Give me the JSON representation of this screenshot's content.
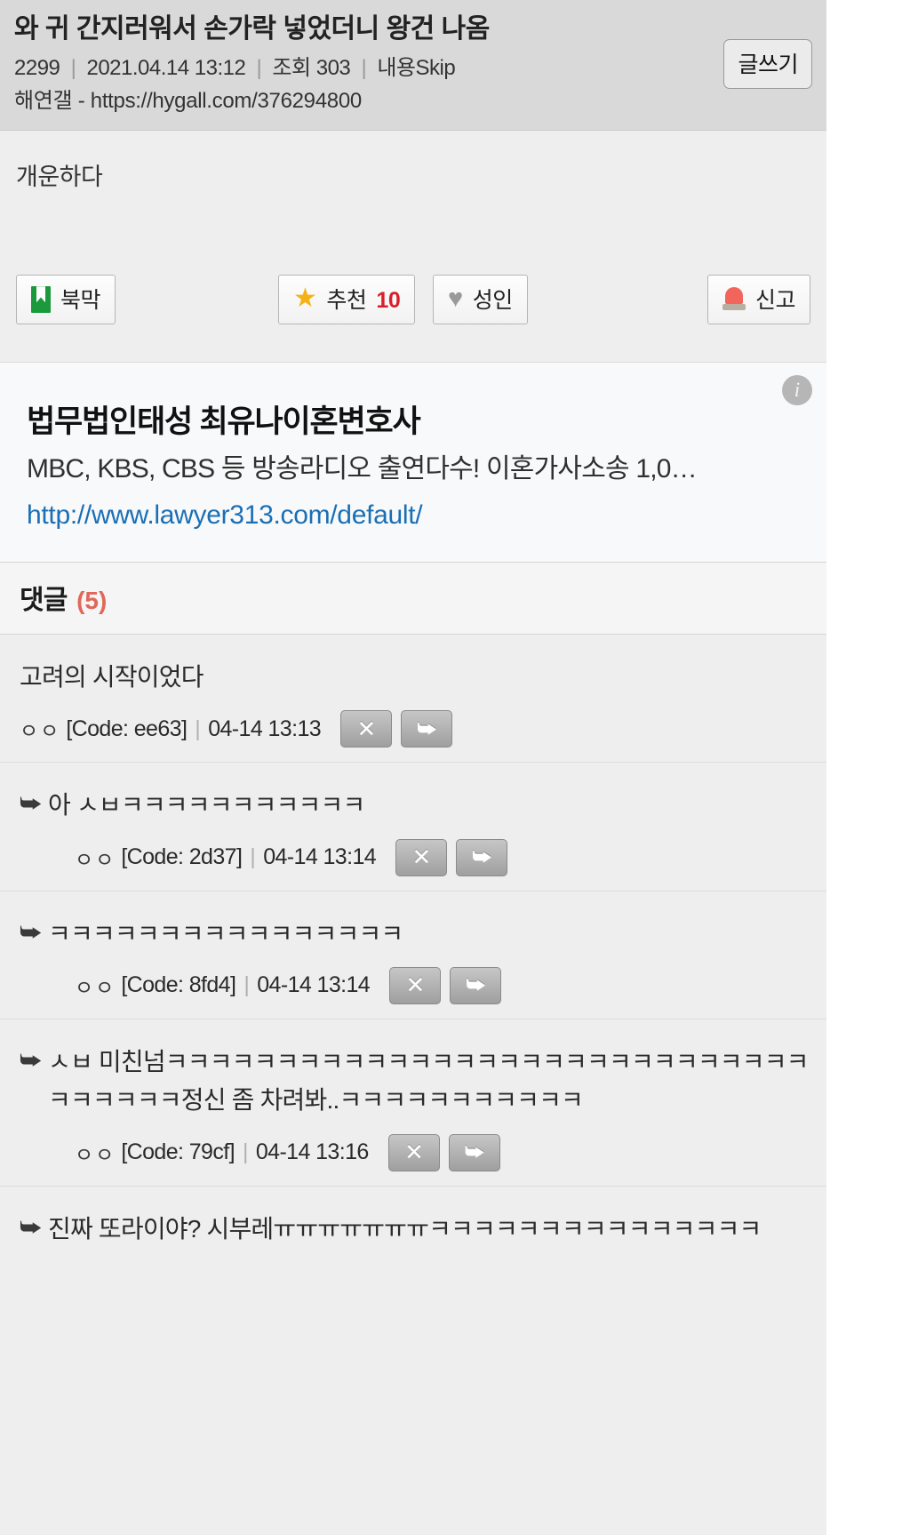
{
  "header": {
    "title": "와 귀 간지러워서 손가락 넣었더니 왕건 나옴",
    "post_number": "2299",
    "datetime": "2021.04.14 13:12",
    "views_label": "조회 303",
    "skip_label": "내용Skip",
    "source": "해연갤 - https://hygall.com/376294800",
    "write_button": "글쓰기"
  },
  "post": {
    "body": "개운하다"
  },
  "actions": {
    "bookmark": "북막",
    "recommend_label": "추천",
    "recommend_count": "10",
    "adult": "성인",
    "report": "신고"
  },
  "ad": {
    "title": "법무법인태성 최유나이혼변호사",
    "description": "MBC, KBS, CBS 등 방송라디오 출연다수! 이혼가사소송 1,0…",
    "url": "http://www.lawyer313.com/default/",
    "info_icon": "i"
  },
  "comments_section": {
    "label": "댓글",
    "count": "(5)",
    "nick_placeholder": "ㅇㅇ",
    "delete_icon": "✕",
    "reply_icon": "⮩",
    "reply_arrow": "⮩",
    "items": [
      {
        "text": "고려의 시작이었다",
        "nick": "ㅇㅇ",
        "code": "[Code: ee63]",
        "time": "04-14 13:13",
        "is_reply": false
      },
      {
        "text": "아 ㅅㅂㅋㅋㅋㅋㅋㅋㅋㅋㅋㅋㅋ",
        "nick": "ㅇㅇ",
        "code": "[Code: 2d37]",
        "time": "04-14 13:14",
        "is_reply": true
      },
      {
        "text": "ㅋㅋㅋㅋㅋㅋㅋㅋㅋㅋㅋㅋㅋㅋㅋㅋ",
        "nick": "ㅇㅇ",
        "code": "[Code: 8fd4]",
        "time": "04-14 13:14",
        "is_reply": true
      },
      {
        "text": "ㅅㅂ 미친넘ㅋㅋㅋㅋㅋㅋㅋㅋㅋㅋㅋㅋㅋㅋㅋㅋㅋㅋㅋㅋㅋㅋㅋㅋㅋㅋㅋㅋㅋㅋㅋㅋㅋㅋㅋ정신 좀 차려봐..ㅋㅋㅋㅋㅋㅋㅋㅋㅋㅋㅋ",
        "nick": "ㅇㅇ",
        "code": "[Code: 79cf]",
        "time": "04-14 13:16",
        "is_reply": true
      },
      {
        "text": "진짜 또라이야? 시부레ㅠㅠㅠㅠㅠㅠㅠㅋㅋㅋㅋㅋㅋㅋㅋㅋㅋㅋㅋㅋㅋㅋ",
        "nick": "",
        "code": "",
        "time": "",
        "is_reply": true
      }
    ]
  }
}
